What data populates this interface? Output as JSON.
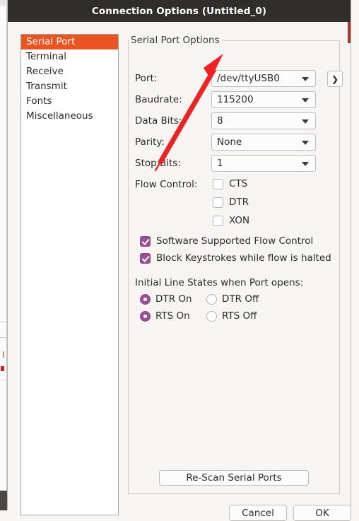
{
  "window": {
    "title": "Connection Options (Untitled_0)"
  },
  "sidebar": {
    "items": [
      {
        "label": "Serial Port",
        "selected": true
      },
      {
        "label": "Terminal",
        "selected": false
      },
      {
        "label": "Receive",
        "selected": false
      },
      {
        "label": "Transmit",
        "selected": false
      },
      {
        "label": "Fonts",
        "selected": false
      },
      {
        "label": "Miscellaneous",
        "selected": false
      }
    ]
  },
  "group": {
    "title": "Serial Port Options"
  },
  "fields": {
    "port": {
      "label": "Port:",
      "value": "/dev/ttyUSB0"
    },
    "baudrate": {
      "label": "Baudrate:",
      "value": "115200"
    },
    "data_bits": {
      "label": "Data Bits:",
      "value": "8"
    },
    "parity": {
      "label": "Parity:",
      "value": "None"
    },
    "stop_bits": {
      "label": "Stop Bits:",
      "value": "1"
    },
    "next_button_label": "❯"
  },
  "flow_control": {
    "label": "Flow Control:",
    "options": [
      {
        "label": "CTS",
        "checked": false
      },
      {
        "label": "DTR",
        "checked": false
      },
      {
        "label": "XON",
        "checked": false
      }
    ]
  },
  "flow_options": [
    {
      "label": "Software Supported Flow Control",
      "checked": true
    },
    {
      "label": "Block Keystrokes while flow is halted",
      "checked": true
    }
  ],
  "initial_line_states": {
    "heading": "Initial Line States when Port opens:",
    "rows": [
      {
        "on_label": "DTR On",
        "on_selected": true,
        "off_label": "DTR Off",
        "off_selected": false
      },
      {
        "on_label": "RTS On",
        "on_selected": true,
        "off_label": "RTS Off",
        "off_selected": false
      }
    ]
  },
  "buttons": {
    "rescan": "Re-Scan Serial Ports",
    "cancel": "Cancel",
    "ok": "OK"
  },
  "colors": {
    "accent_orange": "#e95420",
    "titlebar": "#302e2c",
    "control_purple": "#9b4f96",
    "annotation_red": "#ee2222"
  }
}
